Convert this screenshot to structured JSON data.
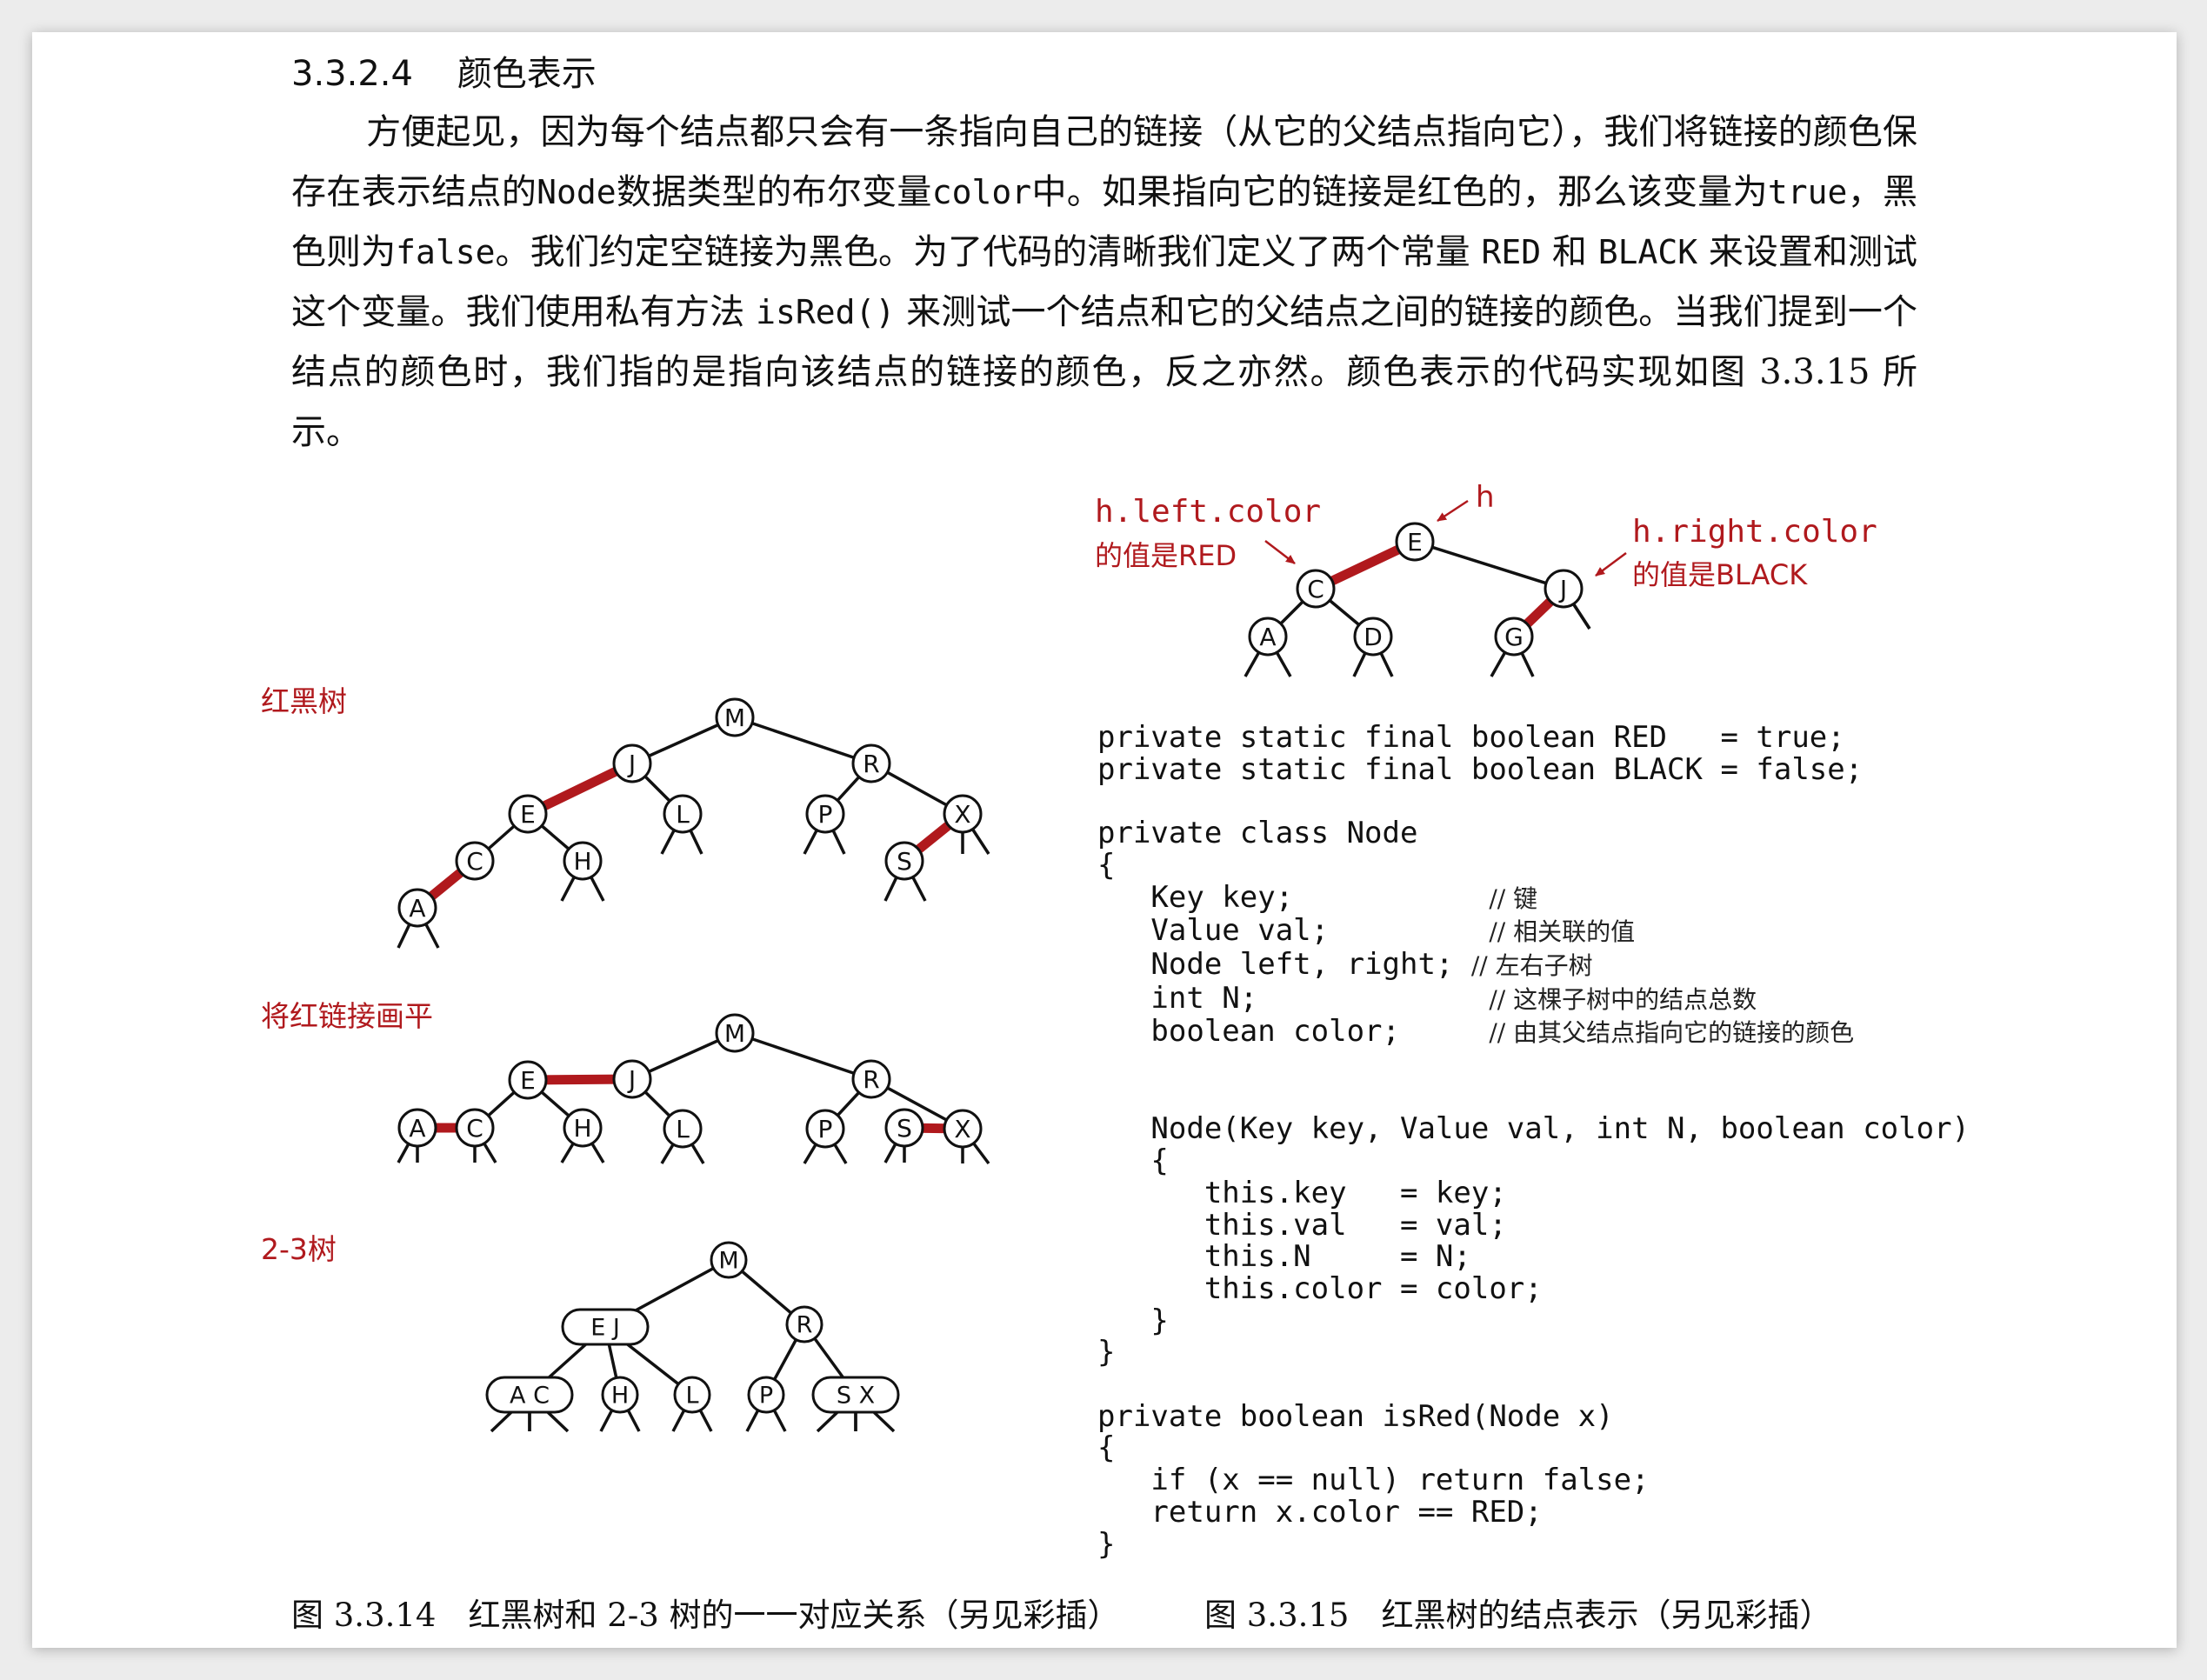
{
  "section": {
    "number": "3.3.2.4",
    "title": "颜色表示"
  },
  "paragraph": [
    "方便起见，因为每个结点都只会有一条指向自己的链接（从它的父结点指向它），我们将链接的颜色保存在表示结点的",
    "Node",
    "数据类型的布尔变量",
    "color",
    "中。如果指向它的链接是红色的，那么该变量为",
    "true",
    "，黑色则为",
    "false",
    "。我们约定空链接为黑色。为了代码的清晰我们定义了两个常量",
    "RED",
    "和",
    "BLACK",
    "来设置和测试这个变量。我们使用私有方法",
    "isRed()",
    "来测试一个结点和它的父结点之间的链接的颜色。当我们提到一个结点的颜色时，我们指的是指向该结点的链接的颜色，反之亦然。颜色表示的代码实现如图 3.3.15 所示。"
  ],
  "figure_left": {
    "label_rb": "红黑树",
    "label_flat": "将红链接画平",
    "label_23": "2-3树",
    "tree1_nodes": [
      "M",
      "J",
      "R",
      "E",
      "L",
      "P",
      "X",
      "C",
      "H",
      "S",
      "A"
    ],
    "tree2_nodes": [
      "M",
      "J",
      "R",
      "E",
      "L",
      "P",
      "X",
      "A",
      "C",
      "H",
      "S"
    ],
    "tree3_nodes": [
      "M",
      "E J",
      "R",
      "A C",
      "H",
      "L",
      "P",
      "S X"
    ],
    "caption": "图 3.3.14　红黑树和 2-3 树的一一对应关系（另见彩插）"
  },
  "figure_right": {
    "label_h": "h",
    "label_left_1": "h.left.color",
    "label_left_2": "的值是RED",
    "label_right_1": "h.right.color",
    "label_right_2": "的值是BLACK",
    "nodes": [
      "E",
      "C",
      "J",
      "A",
      "D",
      "G"
    ],
    "code": {
      "l1": "private static final boolean RED   = true;",
      "l2": "private static final boolean BLACK = false;",
      "l3": "",
      "l4": "private class Node",
      "l5": "{",
      "l6": "   Key key;           ",
      "c6": "// 键",
      "l7": "   Value val;         ",
      "c7": "// 相关联的值",
      "l8": "   Node left, right; ",
      "c8": "// 左右子树",
      "l9": "   int N;             ",
      "c9": "// 这棵子树中的结点总数",
      "l10": "   boolean color;     ",
      "c10": "// 由其父结点指向它的链接的颜色",
      "l11": "",
      "l12": "",
      "l13": "   Node(Key key, Value val, int N, boolean color)",
      "l14": "   {",
      "l15": "      this.key   = key;",
      "l16": "      this.val   = val;",
      "l17": "      this.N     = N;",
      "l18": "      this.color = color;",
      "l19": "   }",
      "l20": "}",
      "l21": "",
      "l22": "private boolean isRed(Node x)",
      "l23": "{",
      "l24": "   if (x == null) return false;",
      "l25": "   return x.color == RED;",
      "l26": "}"
    },
    "caption": "图 3.3.15　红黑树的结点表示（另见彩插）"
  },
  "colors": {
    "red_link": "#b0191d",
    "black_link": "#111111"
  }
}
